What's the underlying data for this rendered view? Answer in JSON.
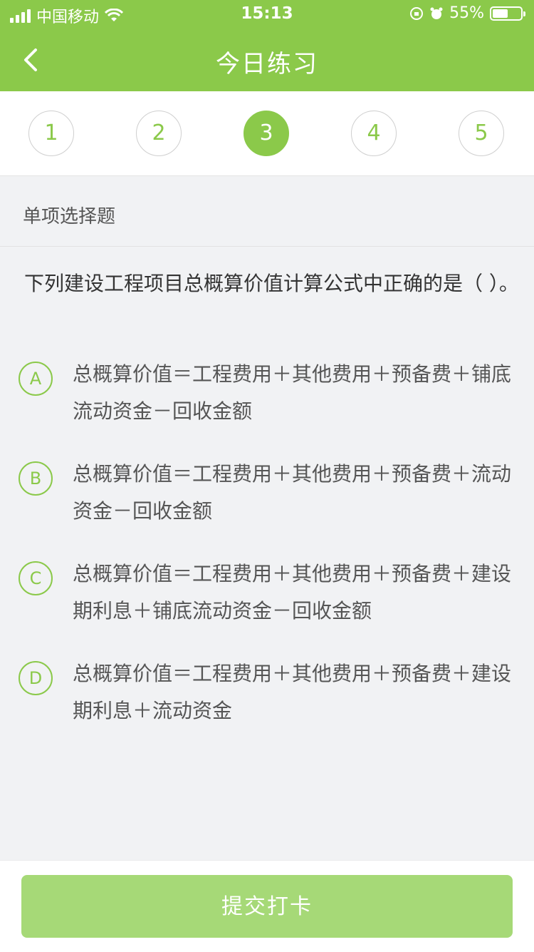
{
  "status_bar": {
    "carrier": "中国移动",
    "time": "15:13",
    "battery_percent": "55%",
    "battery_level": 0.55
  },
  "nav": {
    "title": "今日练习"
  },
  "steps": [
    "1",
    "2",
    "3",
    "4",
    "5"
  ],
  "active_step": 3,
  "question_type": "单项选择题",
  "question": "下列建设工程项目总概算价值计算公式中正确的是（ ）。",
  "options": [
    {
      "letter": "A",
      "text": "总概算价值＝工程费用＋其他费用＋预备费＋铺底流动资金－回收金额"
    },
    {
      "letter": "B",
      "text": "总概算价值＝工程费用＋其他费用＋预备费＋流动资金－回收金额"
    },
    {
      "letter": "C",
      "text": "总概算价值＝工程费用＋其他费用＋预备费＋建设期利息＋铺底流动资金－回收金额"
    },
    {
      "letter": "D",
      "text": "总概算价值＝工程费用＋其他费用＋预备费＋建设期利息＋流动资金"
    }
  ],
  "submit_label": "提交打卡",
  "colors": {
    "brand_green": "#8bc94a",
    "submit_disabled": "#a6d977"
  }
}
